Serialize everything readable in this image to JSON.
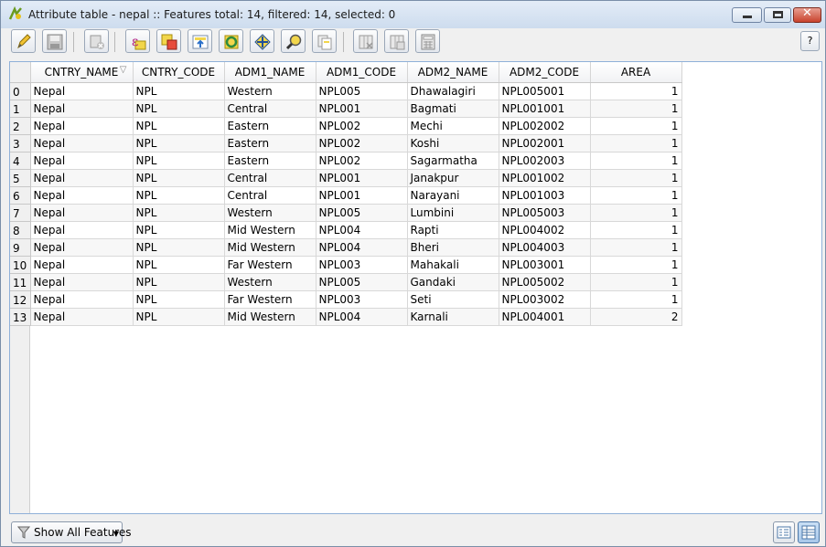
{
  "window": {
    "title": "Attribute table - nepal :: Features total: 14, filtered: 14, selected: 0",
    "app_icon": "qgis-icon"
  },
  "toolbar": {
    "buttons": [
      {
        "name": "toggle-editing-button",
        "icon": "pencil-icon"
      },
      {
        "name": "save-edits-button",
        "icon": "floppy-icon"
      },
      {
        "name": "delete-selected-button",
        "icon": "delete-icon"
      },
      {
        "name": "select-by-expression-button",
        "icon": "expression-icon"
      },
      {
        "name": "unselect-all-button",
        "icon": "unselect-icon"
      },
      {
        "name": "move-selection-top-button",
        "icon": "move-top-icon"
      },
      {
        "name": "invert-selection-button",
        "icon": "invert-icon"
      },
      {
        "name": "pan-to-selection-button",
        "icon": "pan-icon"
      },
      {
        "name": "zoom-to-selection-button",
        "icon": "zoom-icon"
      },
      {
        "name": "copy-selected-button",
        "icon": "copy-icon"
      },
      {
        "name": "delete-column-button",
        "icon": "delete-column-icon"
      },
      {
        "name": "new-column-button",
        "icon": "new-column-icon"
      },
      {
        "name": "field-calculator-button",
        "icon": "calculator-icon"
      }
    ],
    "help_label": "?"
  },
  "table": {
    "columns": [
      "CNTRY_NAME",
      "CNTRY_CODE",
      "ADM1_NAME",
      "ADM1_CODE",
      "ADM2_NAME",
      "ADM2_CODE",
      "AREA"
    ],
    "sorted_column": "CNTRY_NAME",
    "rows": [
      {
        "id": "0",
        "cells": [
          "Nepal",
          "NPL",
          "Western",
          "NPL005",
          "Dhawalagiri",
          "NPL005001",
          "1"
        ]
      },
      {
        "id": "1",
        "cells": [
          "Nepal",
          "NPL",
          "Central",
          "NPL001",
          "Bagmati",
          "NPL001001",
          "1"
        ]
      },
      {
        "id": "2",
        "cells": [
          "Nepal",
          "NPL",
          "Eastern",
          "NPL002",
          "Mechi",
          "NPL002002",
          "1"
        ]
      },
      {
        "id": "3",
        "cells": [
          "Nepal",
          "NPL",
          "Eastern",
          "NPL002",
          "Koshi",
          "NPL002001",
          "1"
        ]
      },
      {
        "id": "4",
        "cells": [
          "Nepal",
          "NPL",
          "Eastern",
          "NPL002",
          "Sagarmatha",
          "NPL002003",
          "1"
        ]
      },
      {
        "id": "5",
        "cells": [
          "Nepal",
          "NPL",
          "Central",
          "NPL001",
          "Janakpur",
          "NPL001002",
          "1"
        ]
      },
      {
        "id": "6",
        "cells": [
          "Nepal",
          "NPL",
          "Central",
          "NPL001",
          "Narayani",
          "NPL001003",
          "1"
        ]
      },
      {
        "id": "7",
        "cells": [
          "Nepal",
          "NPL",
          "Western",
          "NPL005",
          "Lumbini",
          "NPL005003",
          "1"
        ]
      },
      {
        "id": "8",
        "cells": [
          "Nepal",
          "NPL",
          "Mid Western",
          "NPL004",
          "Rapti",
          "NPL004002",
          "1"
        ]
      },
      {
        "id": "9",
        "cells": [
          "Nepal",
          "NPL",
          "Mid Western",
          "NPL004",
          "Bheri",
          "NPL004003",
          "1"
        ]
      },
      {
        "id": "10",
        "cells": [
          "Nepal",
          "NPL",
          "Far Western",
          "NPL003",
          "Mahakali",
          "NPL003001",
          "1"
        ]
      },
      {
        "id": "11",
        "cells": [
          "Nepal",
          "NPL",
          "Western",
          "NPL005",
          "Gandaki",
          "NPL005002",
          "1"
        ]
      },
      {
        "id": "12",
        "cells": [
          "Nepal",
          "NPL",
          "Far Western",
          "NPL003",
          "Seti",
          "NPL003002",
          "1"
        ]
      },
      {
        "id": "13",
        "cells": [
          "Nepal",
          "NPL",
          "Mid Western",
          "NPL004",
          "Karnali",
          "NPL004001",
          "2"
        ]
      }
    ]
  },
  "bottom": {
    "filter_label": "Show All Features",
    "filter_icon": "funnel-icon",
    "views": [
      {
        "name": "form-view-button",
        "icon": "form-view-icon",
        "active": false
      },
      {
        "name": "table-view-button",
        "icon": "table-view-icon",
        "active": true
      }
    ]
  }
}
